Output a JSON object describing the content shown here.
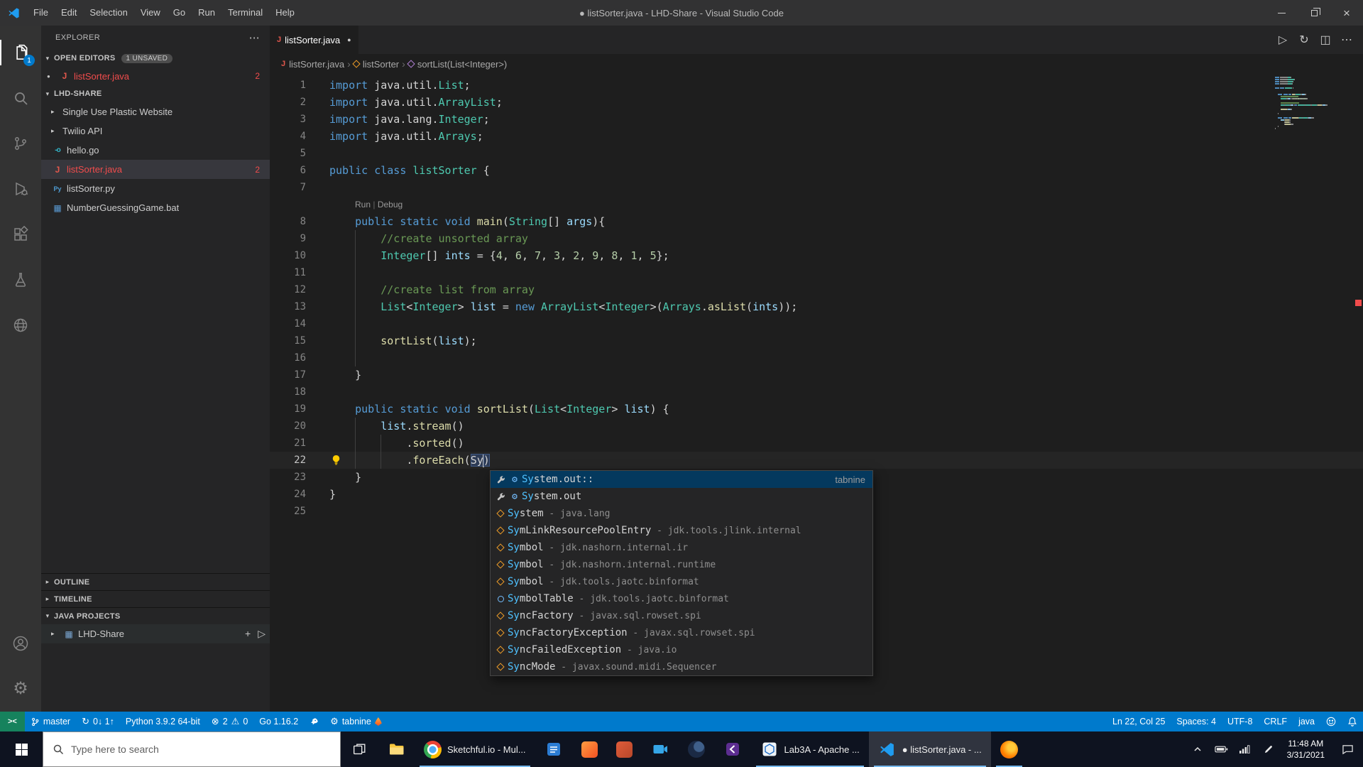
{
  "colors": {
    "accent": "#007acc",
    "statusbar": "#007acc",
    "error": "#f14c4c",
    "remote": "#16825d",
    "selection": "#04395e",
    "editor_bg": "#1e1e1e"
  },
  "window": {
    "title": "● listSorter.java - LHD-Share - Visual Studio Code",
    "menus": [
      "File",
      "Edit",
      "Selection",
      "View",
      "Go",
      "Run",
      "Terminal",
      "Help"
    ]
  },
  "activity_bar": {
    "top": [
      {
        "name": "explorer",
        "icon": "files",
        "active": true,
        "badge": "1"
      },
      {
        "name": "search",
        "icon": "search"
      },
      {
        "name": "source-control",
        "icon": "scm"
      },
      {
        "name": "run-and-debug",
        "icon": "debug"
      },
      {
        "name": "extensions",
        "icon": "extensions"
      },
      {
        "name": "testing",
        "icon": "beaker"
      },
      {
        "name": "remote-explorer",
        "icon": "globe"
      }
    ],
    "bottom": [
      {
        "name": "accounts",
        "icon": "account"
      },
      {
        "name": "manage",
        "icon": "gear"
      }
    ]
  },
  "sidebar": {
    "title": "EXPLORER",
    "open_editors": {
      "label": "OPEN EDITORS",
      "badge": "1 UNSAVED",
      "items": [
        {
          "label": "listSorter.java",
          "filetype": "java",
          "dirty": true,
          "problems": "2"
        }
      ]
    },
    "folder": {
      "label": "LHD-SHARE",
      "items": [
        {
          "label": "Single Use Plastic Website",
          "kind": "folder"
        },
        {
          "label": "Twilio API",
          "kind": "folder"
        },
        {
          "label": "hello.go",
          "kind": "file",
          "filetype": "go"
        },
        {
          "label": "listSorter.java",
          "kind": "file",
          "filetype": "java",
          "problems": "2",
          "error": true,
          "selected": true
        },
        {
          "label": "listSorter.py",
          "kind": "file",
          "filetype": "py"
        },
        {
          "label": "NumberGuessingGame.bat",
          "kind": "file",
          "filetype": "bat"
        }
      ]
    },
    "bottom_sections": [
      {
        "label": "OUTLINE",
        "collapsed": true
      },
      {
        "label": "TIMELINE",
        "collapsed": true
      },
      {
        "label": "JAVA PROJECTS",
        "collapsed": false
      }
    ],
    "java_projects_item": {
      "label": "LHD-Share",
      "actions": [
        "plus",
        "play"
      ]
    }
  },
  "editor": {
    "tab": {
      "label": "listSorter.java",
      "dirty": true
    },
    "actions": [
      {
        "name": "run",
        "icon": "play"
      },
      {
        "name": "run-or-debug",
        "icon": "refresh"
      },
      {
        "name": "split-editor",
        "icon": "split"
      },
      {
        "name": "more-actions",
        "icon": "ellipsis"
      }
    ],
    "breadcrumbs": [
      {
        "label": "listSorter.java",
        "icon": "java-file"
      },
      {
        "label": "listSorter",
        "icon": "symbol-class"
      },
      {
        "label": "sortList(List<Integer>)",
        "icon": "symbol-method"
      }
    ],
    "cursor_position": {
      "line": 22,
      "col": 25
    },
    "lines": [
      {
        "n": 1,
        "g": 0,
        "t": [
          [
            "kw",
            "import"
          ],
          [
            "pl",
            " java.util."
          ],
          [
            "ty",
            "List"
          ],
          [
            "pl",
            ";"
          ]
        ]
      },
      {
        "n": 2,
        "g": 0,
        "t": [
          [
            "kw",
            "import"
          ],
          [
            "pl",
            " java.util."
          ],
          [
            "ty",
            "ArrayList"
          ],
          [
            "pl",
            ";"
          ]
        ]
      },
      {
        "n": 3,
        "g": 0,
        "t": [
          [
            "kw",
            "import"
          ],
          [
            "pl",
            " java.lang."
          ],
          [
            "ty",
            "Integer"
          ],
          [
            "pl",
            ";"
          ]
        ]
      },
      {
        "n": 4,
        "g": 0,
        "t": [
          [
            "kw",
            "import"
          ],
          [
            "pl",
            " java.util."
          ],
          [
            "ty",
            "Arrays"
          ],
          [
            "pl",
            ";"
          ]
        ]
      },
      {
        "n": 5,
        "g": 0,
        "t": []
      },
      {
        "n": 6,
        "g": 0,
        "t": [
          [
            "kw",
            "public"
          ],
          [
            "pl",
            " "
          ],
          [
            "kw",
            "class"
          ],
          [
            "pl",
            " "
          ],
          [
            "ty",
            "listSorter"
          ],
          [
            "pl",
            " {"
          ]
        ]
      },
      {
        "n": 7,
        "g": 0,
        "t": []
      },
      {
        "lens": [
          "Run",
          "Debug"
        ]
      },
      {
        "n": 8,
        "g": 0,
        "t": [
          [
            "pl",
            "    "
          ],
          [
            "kw",
            "public"
          ],
          [
            "pl",
            " "
          ],
          [
            "kw",
            "static"
          ],
          [
            "pl",
            " "
          ],
          [
            "kw",
            "void"
          ],
          [
            "pl",
            " "
          ],
          [
            "fn",
            "main"
          ],
          [
            "pl",
            "("
          ],
          [
            "ty",
            "String"
          ],
          [
            "pl",
            "[] "
          ],
          [
            "vr",
            "args"
          ],
          [
            "pl",
            "){"
          ]
        ]
      },
      {
        "n": 9,
        "g": 1,
        "t": [
          [
            "pl",
            "        "
          ],
          [
            "cm",
            "//create unsorted array"
          ]
        ]
      },
      {
        "n": 10,
        "g": 1,
        "t": [
          [
            "pl",
            "        "
          ],
          [
            "ty",
            "Integer"
          ],
          [
            "pl",
            "[] "
          ],
          [
            "vr",
            "ints"
          ],
          [
            "pl",
            " = {"
          ],
          [
            "nu",
            "4"
          ],
          [
            "pl",
            ", "
          ],
          [
            "nu",
            "6"
          ],
          [
            "pl",
            ", "
          ],
          [
            "nu",
            "7"
          ],
          [
            "pl",
            ", "
          ],
          [
            "nu",
            "3"
          ],
          [
            "pl",
            ", "
          ],
          [
            "nu",
            "2"
          ],
          [
            "pl",
            ", "
          ],
          [
            "nu",
            "9"
          ],
          [
            "pl",
            ", "
          ],
          [
            "nu",
            "8"
          ],
          [
            "pl",
            ", "
          ],
          [
            "nu",
            "1"
          ],
          [
            "pl",
            ", "
          ],
          [
            "nu",
            "5"
          ],
          [
            "pl",
            "};"
          ]
        ]
      },
      {
        "n": 11,
        "g": 1,
        "t": []
      },
      {
        "n": 12,
        "g": 1,
        "t": [
          [
            "pl",
            "        "
          ],
          [
            "cm",
            "//create list from array"
          ]
        ]
      },
      {
        "n": 13,
        "g": 1,
        "t": [
          [
            "pl",
            "        "
          ],
          [
            "ty",
            "List"
          ],
          [
            "pl",
            "<"
          ],
          [
            "ty",
            "Integer"
          ],
          [
            "pl",
            "> "
          ],
          [
            "vr",
            "list"
          ],
          [
            "pl",
            " = "
          ],
          [
            "kw",
            "new"
          ],
          [
            "pl",
            " "
          ],
          [
            "ty",
            "ArrayList"
          ],
          [
            "pl",
            "<"
          ],
          [
            "ty",
            "Integer"
          ],
          [
            "pl",
            ">("
          ],
          [
            "ty",
            "Arrays"
          ],
          [
            "pl",
            "."
          ],
          [
            "fn",
            "asList"
          ],
          [
            "pl",
            "("
          ],
          [
            "vr",
            "ints"
          ],
          [
            "pl",
            "));"
          ]
        ]
      },
      {
        "n": 14,
        "g": 1,
        "t": []
      },
      {
        "n": 15,
        "g": 1,
        "t": [
          [
            "pl",
            "        "
          ],
          [
            "fn",
            "sortList"
          ],
          [
            "pl",
            "("
          ],
          [
            "vr",
            "list"
          ],
          [
            "pl",
            ");"
          ]
        ]
      },
      {
        "n": 16,
        "g": 1,
        "t": []
      },
      {
        "n": 17,
        "g": 0,
        "t": [
          [
            "pl",
            "    }"
          ]
        ]
      },
      {
        "n": 18,
        "g": 0,
        "t": []
      },
      {
        "n": 19,
        "g": 0,
        "t": [
          [
            "pl",
            "    "
          ],
          [
            "kw",
            "public"
          ],
          [
            "pl",
            " "
          ],
          [
            "kw",
            "static"
          ],
          [
            "pl",
            " "
          ],
          [
            "kw",
            "void"
          ],
          [
            "pl",
            " "
          ],
          [
            "fn",
            "sortList"
          ],
          [
            "pl",
            "("
          ],
          [
            "ty",
            "List"
          ],
          [
            "pl",
            "<"
          ],
          [
            "ty",
            "Integer"
          ],
          [
            "pl",
            "> "
          ],
          [
            "vr",
            "list"
          ],
          [
            "pl",
            ") {"
          ]
        ]
      },
      {
        "n": 20,
        "g": 1,
        "t": [
          [
            "pl",
            "        "
          ],
          [
            "vr",
            "list"
          ],
          [
            "pl",
            "."
          ],
          [
            "fn",
            "stream"
          ],
          [
            "pl",
            "()"
          ]
        ]
      },
      {
        "n": 21,
        "g": 2,
        "t": [
          [
            "pl",
            "            ."
          ],
          [
            "fn",
            "sorted"
          ],
          [
            "pl",
            "()"
          ]
        ]
      },
      {
        "n": 22,
        "g": 2,
        "cur": true,
        "t": [
          [
            "pl",
            "            ."
          ],
          [
            "fn",
            "foreEach"
          ],
          [
            "pl",
            "("
          ],
          [
            "bx",
            "Sy"
          ],
          [
            "cursor",
            ""
          ],
          [
            "bx",
            ")"
          ]
        ]
      },
      {
        "n": 23,
        "g": 0,
        "t": [
          [
            "pl",
            "    }"
          ]
        ]
      },
      {
        "n": 24,
        "g": 0,
        "t": [
          [
            "pl",
            "}"
          ]
        ]
      },
      {
        "n": 25,
        "g": 0,
        "t": []
      }
    ]
  },
  "suggest": {
    "items": [
      {
        "icons": [
          "wrench",
          "gearblue"
        ],
        "label": "System.out::",
        "match": "Sy",
        "right": "tabnine",
        "selected": true
      },
      {
        "icons": [
          "wrench",
          "gearblue"
        ],
        "label": "System.out",
        "match": "Sy"
      },
      {
        "icons": [
          "symbol-class"
        ],
        "label": "System",
        "match": "Sy",
        "detail": "java.lang"
      },
      {
        "icons": [
          "symbol-class"
        ],
        "label": "SymLinkResourcePoolEntry",
        "match": "Sy",
        "detail": "jdk.tools.jlink.internal"
      },
      {
        "icons": [
          "symbol-class"
        ],
        "label": "Symbol",
        "match": "Sy",
        "detail": "jdk.nashorn.internal.ir"
      },
      {
        "icons": [
          "symbol-class"
        ],
        "label": "Symbol",
        "match": "Sy",
        "detail": "jdk.nashorn.internal.runtime"
      },
      {
        "icons": [
          "symbol-class"
        ],
        "label": "Symbol",
        "match": "Sy",
        "detail": "jdk.tools.jaotc.binformat"
      },
      {
        "icons": [
          "symbol-interface"
        ],
        "label": "SymbolTable",
        "match": "Sy",
        "detail": "jdk.tools.jaotc.binformat"
      },
      {
        "icons": [
          "symbol-class"
        ],
        "label": "SyncFactory",
        "match": "Sy",
        "detail": "javax.sql.rowset.spi"
      },
      {
        "icons": [
          "symbol-class"
        ],
        "label": "SyncFactoryException",
        "match": "Sy",
        "detail": "javax.sql.rowset.spi"
      },
      {
        "icons": [
          "symbol-class"
        ],
        "label": "SyncFailedException",
        "match": "Sy",
        "detail": "java.io"
      },
      {
        "icons": [
          "symbol-class"
        ],
        "label": "SyncMode",
        "match": "Sy",
        "detail": "javax.sound.midi.Sequencer"
      }
    ]
  },
  "status_bar": {
    "left": [
      {
        "name": "remote-indicator",
        "cls": "remote",
        "parts": [
          {
            "icon": "remote"
          }
        ]
      },
      {
        "name": "git-branch",
        "parts": [
          {
            "icon": "branch"
          },
          {
            "text": "master"
          }
        ]
      },
      {
        "name": "git-sync",
        "parts": [
          {
            "icon": "sync"
          },
          {
            "text": "0↓ 1↑"
          }
        ]
      },
      {
        "name": "python-interpreter",
        "parts": [
          {
            "text": "Python 3.9.2 64-bit"
          }
        ]
      },
      {
        "name": "problems",
        "parts": [
          {
            "icon": "error"
          },
          {
            "text": "2"
          },
          {
            "icon": "warning"
          },
          {
            "text": "0"
          }
        ]
      },
      {
        "name": "go-version",
        "parts": [
          {
            "text": "Go 1.16.2"
          }
        ]
      },
      {
        "name": "java-status",
        "parts": [
          {
            "icon": "rocket"
          }
        ]
      },
      {
        "name": "tabnine",
        "parts": [
          {
            "icon": "gear2"
          },
          {
            "text": "tabnine"
          },
          {
            "icon": "flame"
          }
        ]
      }
    ],
    "right": [
      {
        "name": "cursor-position",
        "parts": [
          {
            "text": "Ln 22, Col 25"
          }
        ]
      },
      {
        "name": "indentation",
        "parts": [
          {
            "text": "Spaces: 4"
          }
        ]
      },
      {
        "name": "encoding",
        "parts": [
          {
            "text": "UTF-8"
          }
        ]
      },
      {
        "name": "eol",
        "parts": [
          {
            "text": "CRLF"
          }
        ]
      },
      {
        "name": "language-mode",
        "parts": [
          {
            "text": "java"
          }
        ]
      },
      {
        "name": "feedback",
        "parts": [
          {
            "icon": "smiley"
          }
        ]
      },
      {
        "name": "notifications",
        "parts": [
          {
            "icon": "bell"
          }
        ]
      }
    ]
  },
  "taskbar": {
    "search": {
      "placeholder": "Type here to search"
    },
    "apps": [
      {
        "name": "task-view",
        "icon": "taskview"
      },
      {
        "name": "file-explorer",
        "icon": "folder"
      },
      {
        "name": "chrome-window",
        "icon": "chrome",
        "label": "Sketchful.io - Mul...",
        "open": true
      },
      {
        "name": "app-blue-doc",
        "icon": "worddoc"
      },
      {
        "name": "app-orange",
        "icon": "orangeapp"
      },
      {
        "name": "app-red",
        "icon": "redapp"
      },
      {
        "name": "camera-app",
        "icon": "camera"
      },
      {
        "name": "app-dark-circle",
        "icon": "darkapp"
      },
      {
        "name": "app-purple",
        "icon": "purpleapp"
      },
      {
        "name": "netbeans-window",
        "icon": "netbeans",
        "label": "Lab3A - Apache ...",
        "open": true
      },
      {
        "name": "vscode-window",
        "icon": "vscode",
        "label": "● listSorter.java - ...",
        "open": true,
        "active": true
      },
      {
        "name": "firefox",
        "icon": "firefox",
        "open": true
      }
    ],
    "tray": {
      "icons": [
        {
          "name": "hidden-icons",
          "icon": "chevup"
        },
        {
          "name": "battery",
          "icon": "battery"
        },
        {
          "name": "network",
          "icon": "wifi"
        },
        {
          "name": "pen",
          "icon": "pen"
        }
      ],
      "time": "11:48 AM",
      "date": "3/31/2021",
      "notification": {
        "name": "action-center",
        "icon": "notifybubble"
      }
    }
  }
}
